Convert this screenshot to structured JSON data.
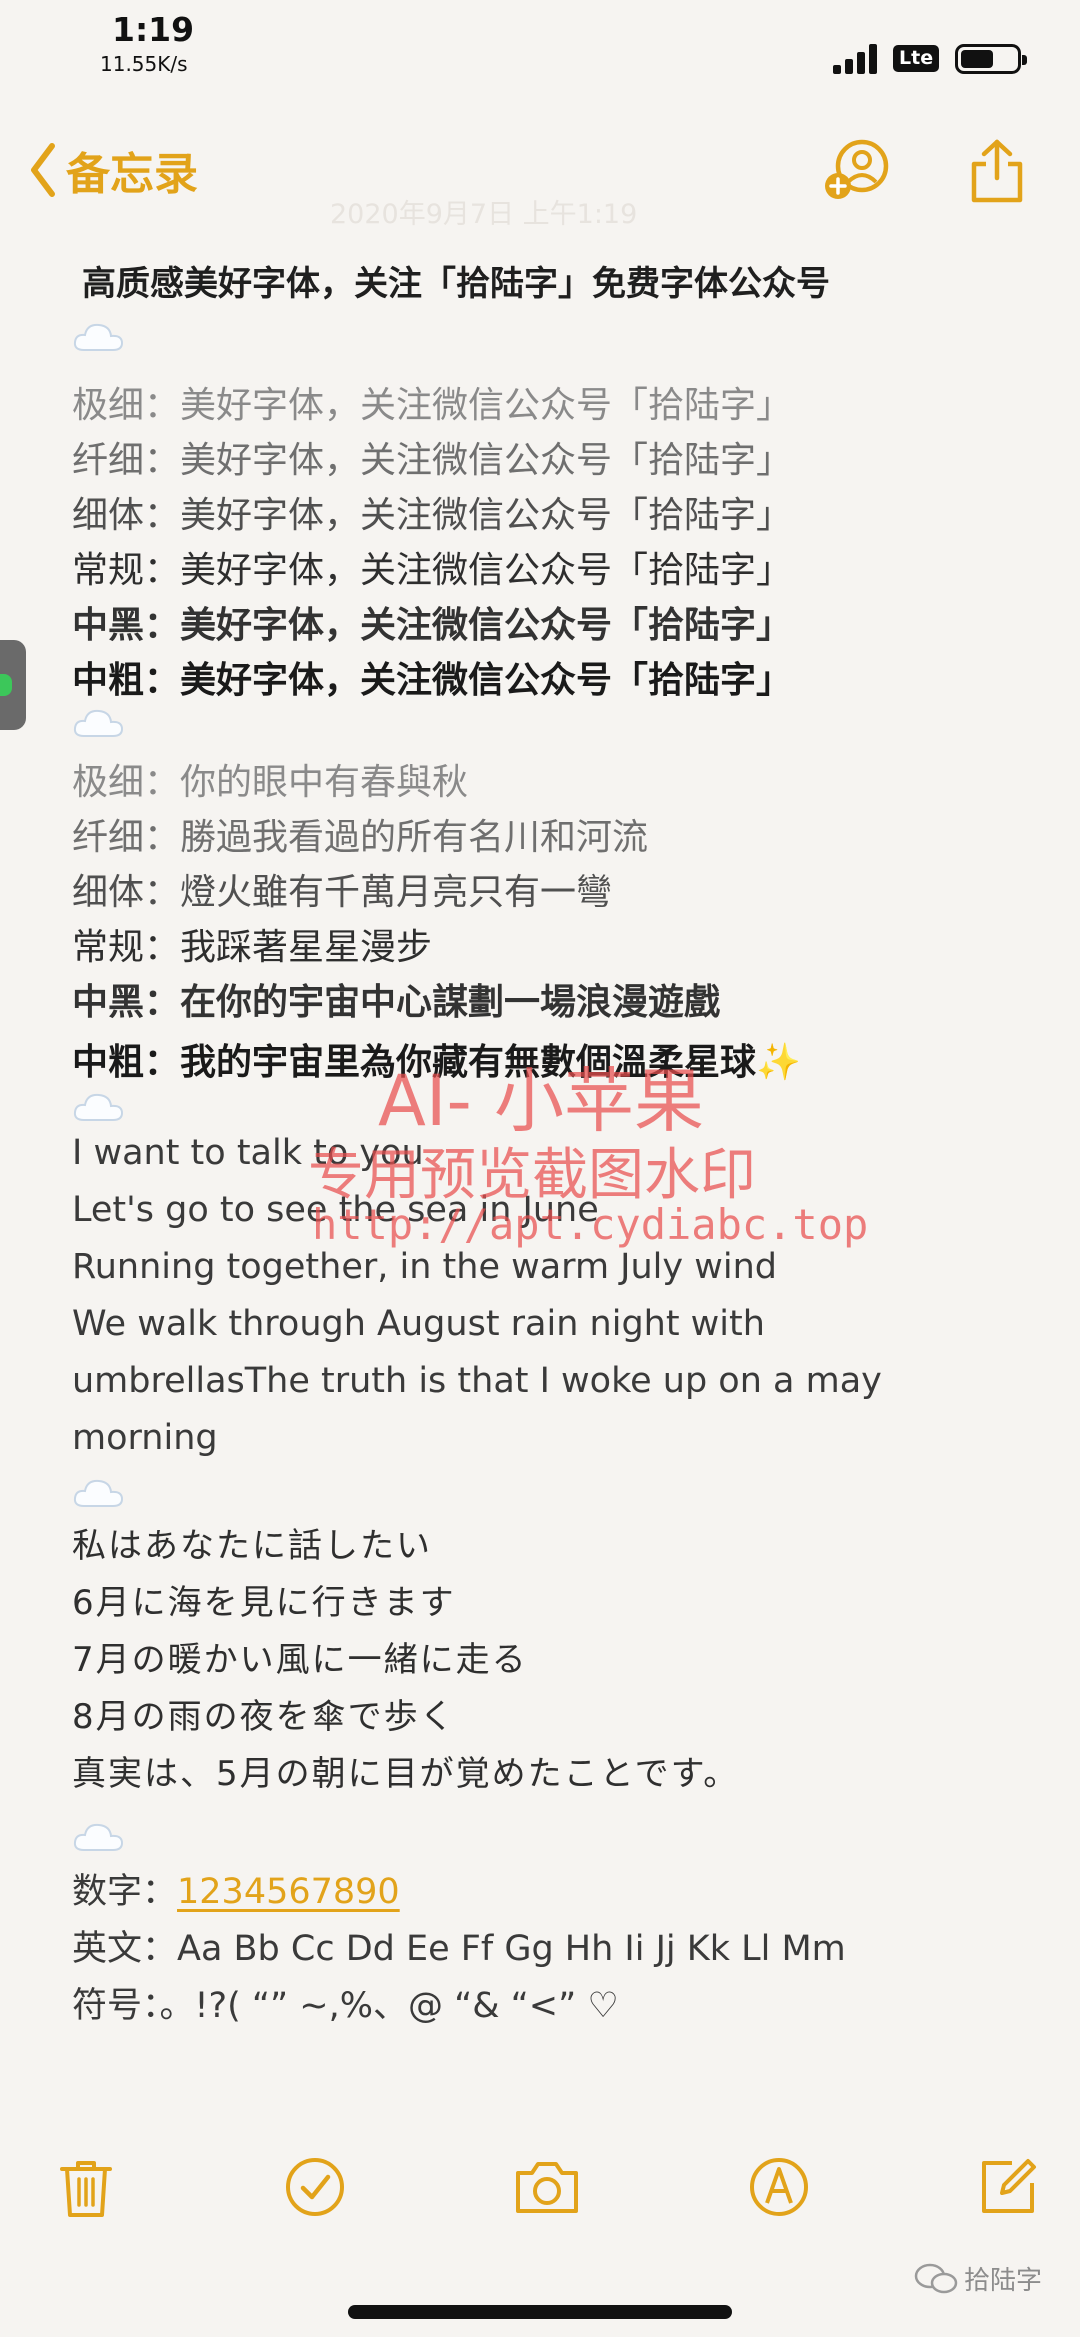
{
  "status": {
    "time": "1:19",
    "speed": "11.55K/s",
    "network": "Lte"
  },
  "nav": {
    "back_label": "备忘录",
    "date": "2020年9月7日 上午1:19"
  },
  "note": {
    "heading": "高质感美好字体，关注「拾陆字」免费字体公众号",
    "block1": [
      {
        "label": "极细：",
        "text": "美好字体，关注微信公众号「拾陆字」"
      },
      {
        "label": "纤细：",
        "text": "美好字体，关注微信公众号「拾陆字」"
      },
      {
        "label": "细体：",
        "text": "美好字体，关注微信公众号「拾陆字」"
      },
      {
        "label": "常规：",
        "text": "美好字体，关注微信公众号「拾陆字」"
      },
      {
        "label": "中黑：",
        "text": "美好字体，关注微信公众号「拾陆字」"
      },
      {
        "label": "中粗：",
        "text": "美好字体，关注微信公众号「拾陆字」"
      }
    ],
    "block2": [
      {
        "label": "极细：",
        "text": "你的眼中有春與秋"
      },
      {
        "label": "纤细：",
        "text": "勝過我看過的所有名川和河流"
      },
      {
        "label": "细体：",
        "text": "燈火雖有千萬月亮只有一彎"
      },
      {
        "label": "常规：",
        "text": "我踩著星星漫步"
      },
      {
        "label": "中黑：",
        "text": "在你的宇宙中心謀劃一場浪漫遊戲"
      },
      {
        "label": "中粗：",
        "text": "我的宇宙里為你藏有無數個溫柔星球✨"
      }
    ],
    "english": [
      "I want to talk to you",
      "Let's go to see the sea in June",
      "Running together, in the warm July wind",
      "We walk through August rain night with",
      "umbrellasThe truth is that I woke up on a may",
      "morning"
    ],
    "japanese": [
      "私はあなたに話したい",
      "6月に海を見に行きます",
      "7月の暖かい風に一緒に走る",
      "8月の雨の夜を傘で歩く",
      "真実は、5月の朝に目が覚めたことです。"
    ],
    "digits_label": "数字：",
    "digits_value": "1234567890",
    "letters_label": "英文：",
    "letters_value": "Aa Bb Cc Dd Ee Ff Gg Hh Ii Jj Kk Ll Mm",
    "symbols_label": "符号：",
    "symbols_value": "。!?( “” ~,%、@ “& “<” ♡"
  },
  "watermark": {
    "line1": "AI- 小苹果",
    "line2": "专用预览截图水印",
    "line3": "http://apt.cydiabc.top"
  },
  "brand": "拾陆字",
  "colors": {
    "accent": "#e2a31a",
    "background": "#f6f4f1",
    "watermark": "#e84e4e"
  },
  "icons": [
    "add-person-icon",
    "share-icon",
    "trash-icon",
    "checklist-icon",
    "camera-icon",
    "markup-icon",
    "compose-icon",
    "cloud-icon"
  ]
}
